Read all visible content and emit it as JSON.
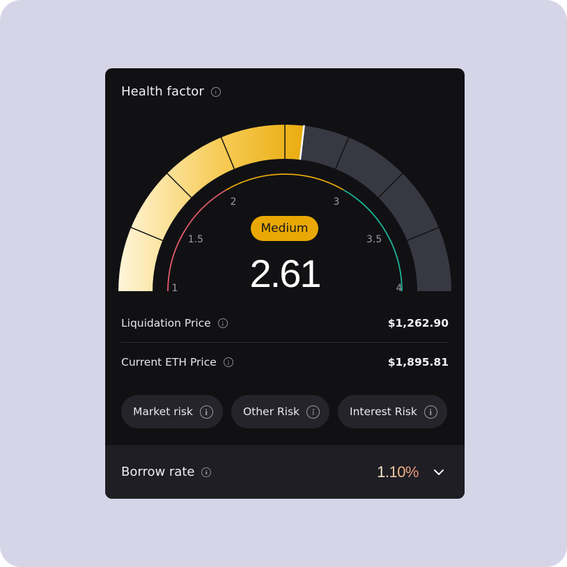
{
  "card": {
    "title": "Health factor",
    "status_badge": "Medium",
    "health_value": "2.61",
    "gauge": {
      "min": 1,
      "max": 4,
      "value": 2.61,
      "tick_labels": [
        "1",
        "1.5",
        "2",
        "3",
        "3.5",
        "4"
      ],
      "colors": {
        "accent": "#e9a805",
        "track_inactive": "#383842",
        "risk_low": "#19b394",
        "risk_high": "#e25a6a"
      }
    },
    "liquidation": {
      "label": "Liquidation Price",
      "value": "$1,262.90"
    },
    "current_price": {
      "label": "Current ETH Price",
      "value": "$1,895.81"
    },
    "chips": [
      {
        "label": "Market risk",
        "icon": "info-icon"
      },
      {
        "label": "Other Risk",
        "icon": "info-icon"
      },
      {
        "label": "Interest Risk",
        "icon": "info-icon"
      }
    ],
    "footer": {
      "label": "Borrow rate",
      "value": "1.10%",
      "icon": "chevron-down-icon"
    }
  }
}
